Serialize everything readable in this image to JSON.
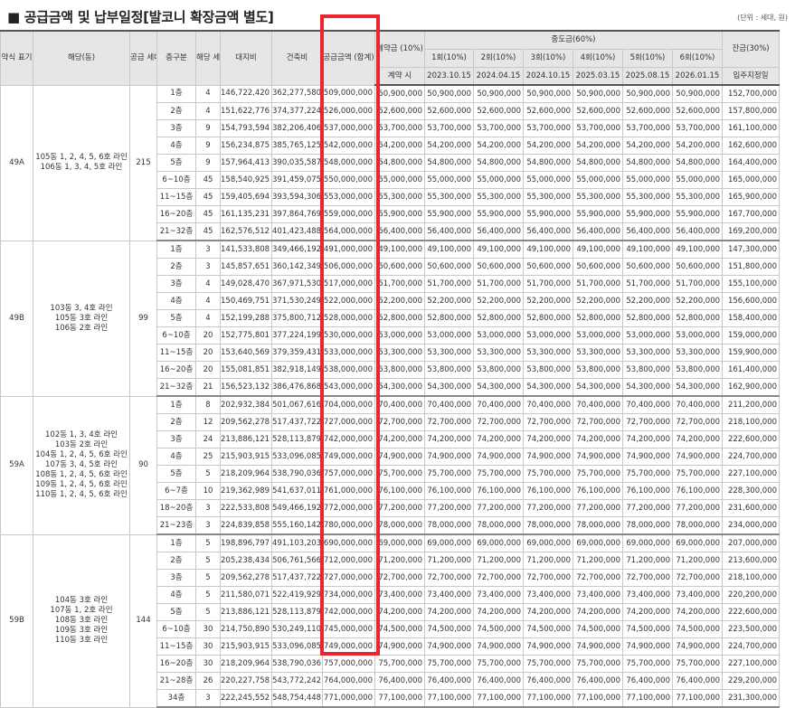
{
  "title": "■ 공급금액 및 납부일정[발코니 확장금액 별도]",
  "unit_note": "(단위 : 세대, 원)",
  "headers": {
    "type": "약식 표기",
    "dong": "해당(동)",
    "supply_units": "공급 세대수",
    "floor": "층구분",
    "units": "해당 세대수",
    "land": "대지비",
    "building": "건축비",
    "total": "공급금액 (합계)",
    "deposit": "계약금 (10%)",
    "deposit_when": "계약 시",
    "interim": "중도금(60%)",
    "balance": "잔금(30%)",
    "balance_when": "입주지정일",
    "installments": [
      "1회(10%)",
      "2회(10%)",
      "3회(10%)",
      "4회(10%)",
      "5회(10%)",
      "6회(10%)"
    ],
    "dates": [
      "2023.10.15",
      "2024.04.15",
      "2024.10.15",
      "2025.03.15",
      "2025.08.15",
      "2026.01.15"
    ]
  },
  "groups": [
    {
      "type": "49A",
      "dong_lines": [
        "105동 1, 2, 4, 5, 6호 라인",
        "106동 1, 3, 4, 5호 라인"
      ],
      "supply": "215",
      "rows": [
        [
          "1층",
          "4",
          "146,722,420",
          "362,277,580",
          "509,000,000",
          "50,900,000",
          "50,900,000",
          "50,900,000",
          "50,900,000",
          "50,900,000",
          "50,900,000",
          "50,900,000",
          "152,700,000"
        ],
        [
          "2층",
          "4",
          "151,622,776",
          "374,377,224",
          "526,000,000",
          "52,600,000",
          "52,600,000",
          "52,600,000",
          "52,600,000",
          "52,600,000",
          "52,600,000",
          "52,600,000",
          "157,800,000"
        ],
        [
          "3층",
          "9",
          "154,793,594",
          "382,206,406",
          "537,000,000",
          "53,700,000",
          "53,700,000",
          "53,700,000",
          "53,700,000",
          "53,700,000",
          "53,700,000",
          "53,700,000",
          "161,100,000"
        ],
        [
          "4층",
          "9",
          "156,234,875",
          "385,765,125",
          "542,000,000",
          "54,200,000",
          "54,200,000",
          "54,200,000",
          "54,200,000",
          "54,200,000",
          "54,200,000",
          "54,200,000",
          "162,600,000"
        ],
        [
          "5층",
          "9",
          "157,964,413",
          "390,035,587",
          "548,000,000",
          "54,800,000",
          "54,800,000",
          "54,800,000",
          "54,800,000",
          "54,800,000",
          "54,800,000",
          "54,800,000",
          "164,400,000"
        ],
        [
          "6~10층",
          "45",
          "158,540,925",
          "391,459,075",
          "550,000,000",
          "55,000,000",
          "55,000,000",
          "55,000,000",
          "55,000,000",
          "55,000,000",
          "55,000,000",
          "55,000,000",
          "165,000,000"
        ],
        [
          "11~15층",
          "45",
          "159,405,694",
          "393,594,306",
          "553,000,000",
          "55,300,000",
          "55,300,000",
          "55,300,000",
          "55,300,000",
          "55,300,000",
          "55,300,000",
          "55,300,000",
          "165,900,000"
        ],
        [
          "16~20층",
          "45",
          "161,135,231",
          "397,864,769",
          "559,000,000",
          "55,900,000",
          "55,900,000",
          "55,900,000",
          "55,900,000",
          "55,900,000",
          "55,900,000",
          "55,900,000",
          "167,700,000"
        ],
        [
          "21~32층",
          "45",
          "162,576,512",
          "401,423,488",
          "564,000,000",
          "56,400,000",
          "56,400,000",
          "56,400,000",
          "56,400,000",
          "56,400,000",
          "56,400,000",
          "56,400,000",
          "169,200,000"
        ]
      ]
    },
    {
      "type": "49B",
      "dong_lines": [
        "103동 3, 4호 라인",
        "105동 3호 라인",
        "106동 2호 라인"
      ],
      "supply": "99",
      "rows": [
        [
          "1층",
          "3",
          "141,533,808",
          "349,466,192",
          "491,000,000",
          "49,100,000",
          "49,100,000",
          "49,100,000",
          "49,100,000",
          "49,100,000",
          "49,100,000",
          "49,100,000",
          "147,300,000"
        ],
        [
          "2층",
          "3",
          "145,857,651",
          "360,142,349",
          "506,000,000",
          "50,600,000",
          "50,600,000",
          "50,600,000",
          "50,600,000",
          "50,600,000",
          "50,600,000",
          "50,600,000",
          "151,800,000"
        ],
        [
          "3층",
          "4",
          "149,028,470",
          "367,971,530",
          "517,000,000",
          "51,700,000",
          "51,700,000",
          "51,700,000",
          "51,700,000",
          "51,700,000",
          "51,700,000",
          "51,700,000",
          "155,100,000"
        ],
        [
          "4층",
          "4",
          "150,469,751",
          "371,530,249",
          "522,000,000",
          "52,200,000",
          "52,200,000",
          "52,200,000",
          "52,200,000",
          "52,200,000",
          "52,200,000",
          "52,200,000",
          "156,600,000"
        ],
        [
          "5층",
          "4",
          "152,199,288",
          "375,800,712",
          "528,000,000",
          "52,800,000",
          "52,800,000",
          "52,800,000",
          "52,800,000",
          "52,800,000",
          "52,800,000",
          "52,800,000",
          "158,400,000"
        ],
        [
          "6~10층",
          "20",
          "152,775,801",
          "377,224,199",
          "530,000,000",
          "53,000,000",
          "53,000,000",
          "53,000,000",
          "53,000,000",
          "53,000,000",
          "53,000,000",
          "53,000,000",
          "159,000,000"
        ],
        [
          "11~15층",
          "20",
          "153,640,569",
          "379,359,431",
          "533,000,000",
          "53,300,000",
          "53,300,000",
          "53,300,000",
          "53,300,000",
          "53,300,000",
          "53,300,000",
          "53,300,000",
          "159,900,000"
        ],
        [
          "16~20층",
          "20",
          "155,081,851",
          "382,918,149",
          "538,000,000",
          "53,800,000",
          "53,800,000",
          "53,800,000",
          "53,800,000",
          "53,800,000",
          "53,800,000",
          "53,800,000",
          "161,400,000"
        ],
        [
          "21~32층",
          "21",
          "156,523,132",
          "386,476,868",
          "543,000,000",
          "54,300,000",
          "54,300,000",
          "54,300,000",
          "54,300,000",
          "54,300,000",
          "54,300,000",
          "54,300,000",
          "162,900,000"
        ]
      ]
    },
    {
      "type": "59A",
      "dong_lines": [
        "102동 1, 3, 4호 라인",
        "103동 2호 라인",
        "104동 1, 2, 4, 5, 6호 라인",
        "107동 3, 4, 5호 라인",
        "108동 1, 2, 4, 5, 6호 라인",
        "109동 1, 2, 4, 5, 6호 라인",
        "110동 1, 2, 4, 5, 6호 라인"
      ],
      "supply": "90",
      "rows": [
        [
          "1층",
          "8",
          "202,932,384",
          "501,067,616",
          "704,000,000",
          "70,400,000",
          "70,400,000",
          "70,400,000",
          "70,400,000",
          "70,400,000",
          "70,400,000",
          "70,400,000",
          "211,200,000"
        ],
        [
          "2층",
          "12",
          "209,562,278",
          "517,437,722",
          "727,000,000",
          "72,700,000",
          "72,700,000",
          "72,700,000",
          "72,700,000",
          "72,700,000",
          "72,700,000",
          "72,700,000",
          "218,100,000"
        ],
        [
          "3층",
          "24",
          "213,886,121",
          "528,113,879",
          "742,000,000",
          "74,200,000",
          "74,200,000",
          "74,200,000",
          "74,200,000",
          "74,200,000",
          "74,200,000",
          "74,200,000",
          "222,600,000"
        ],
        [
          "4층",
          "25",
          "215,903,915",
          "533,096,085",
          "749,000,000",
          "74,900,000",
          "74,900,000",
          "74,900,000",
          "74,900,000",
          "74,900,000",
          "74,900,000",
          "74,900,000",
          "224,700,000"
        ],
        [
          "5층",
          "5",
          "218,209,964",
          "538,790,036",
          "757,000,000",
          "75,700,000",
          "75,700,000",
          "75,700,000",
          "75,700,000",
          "75,700,000",
          "75,700,000",
          "75,700,000",
          "227,100,000"
        ],
        [
          "6~7층",
          "10",
          "219,362,989",
          "541,637,011",
          "761,000,000",
          "76,100,000",
          "76,100,000",
          "76,100,000",
          "76,100,000",
          "76,100,000",
          "76,100,000",
          "76,100,000",
          "228,300,000"
        ],
        [
          "18~20층",
          "3",
          "222,533,808",
          "549,466,192",
          "772,000,000",
          "77,200,000",
          "77,200,000",
          "77,200,000",
          "77,200,000",
          "77,200,000",
          "77,200,000",
          "77,200,000",
          "231,600,000"
        ],
        [
          "21~23층",
          "3",
          "224,839,858",
          "555,160,142",
          "780,000,000",
          "78,000,000",
          "78,000,000",
          "78,000,000",
          "78,000,000",
          "78,000,000",
          "78,000,000",
          "78,000,000",
          "234,000,000"
        ]
      ]
    },
    {
      "type": "59B",
      "dong_lines": [
        "104동 3호 라인",
        "107동 1, 2호 라인",
        "108동 3호 라인",
        "109동 3호 라인",
        "110동 3호 라인"
      ],
      "supply": "144",
      "rows": [
        [
          "1층",
          "5",
          "198,896,797",
          "491,103,203",
          "690,000,000",
          "69,000,000",
          "69,000,000",
          "69,000,000",
          "69,000,000",
          "69,000,000",
          "69,000,000",
          "69,000,000",
          "207,000,000"
        ],
        [
          "2층",
          "5",
          "205,238,434",
          "506,761,566",
          "712,000,000",
          "71,200,000",
          "71,200,000",
          "71,200,000",
          "71,200,000",
          "71,200,000",
          "71,200,000",
          "71,200,000",
          "213,600,000"
        ],
        [
          "3층",
          "5",
          "209,562,278",
          "517,437,722",
          "727,000,000",
          "72,700,000",
          "72,700,000",
          "72,700,000",
          "72,700,000",
          "72,700,000",
          "72,700,000",
          "72,700,000",
          "218,100,000"
        ],
        [
          "4층",
          "5",
          "211,580,071",
          "522,419,929",
          "734,000,000",
          "73,400,000",
          "73,400,000",
          "73,400,000",
          "73,400,000",
          "73,400,000",
          "73,400,000",
          "73,400,000",
          "220,200,000"
        ],
        [
          "5층",
          "5",
          "213,886,121",
          "528,113,879",
          "742,000,000",
          "74,200,000",
          "74,200,000",
          "74,200,000",
          "74,200,000",
          "74,200,000",
          "74,200,000",
          "74,200,000",
          "222,600,000"
        ],
        [
          "6~10층",
          "30",
          "214,750,890",
          "530,249,110",
          "745,000,000",
          "74,500,000",
          "74,500,000",
          "74,500,000",
          "74,500,000",
          "74,500,000",
          "74,500,000",
          "74,500,000",
          "223,500,000"
        ],
        [
          "11~15층",
          "30",
          "215,903,915",
          "533,096,085",
          "749,000,000",
          "74,900,000",
          "74,900,000",
          "74,900,000",
          "74,900,000",
          "74,900,000",
          "74,900,000",
          "74,900,000",
          "224,700,000"
        ],
        [
          "16~20층",
          "30",
          "218,209,964",
          "538,790,036",
          "757,000,000",
          "75,700,000",
          "75,700,000",
          "75,700,000",
          "75,700,000",
          "75,700,000",
          "75,700,000",
          "75,700,000",
          "227,100,000"
        ],
        [
          "21~28층",
          "26",
          "220,227,758",
          "543,772,242",
          "764,000,000",
          "76,400,000",
          "76,400,000",
          "76,400,000",
          "76,400,000",
          "76,400,000",
          "76,400,000",
          "76,400,000",
          "229,200,000"
        ],
        [
          "34층",
          "3",
          "222,245,552",
          "548,754,448",
          "771,000,000",
          "77,100,000",
          "77,100,000",
          "77,100,000",
          "77,100,000",
          "77,100,000",
          "77,100,000",
          "77,100,000",
          "231,300,000"
        ]
      ]
    }
  ],
  "highlight_color": "#e8262b"
}
